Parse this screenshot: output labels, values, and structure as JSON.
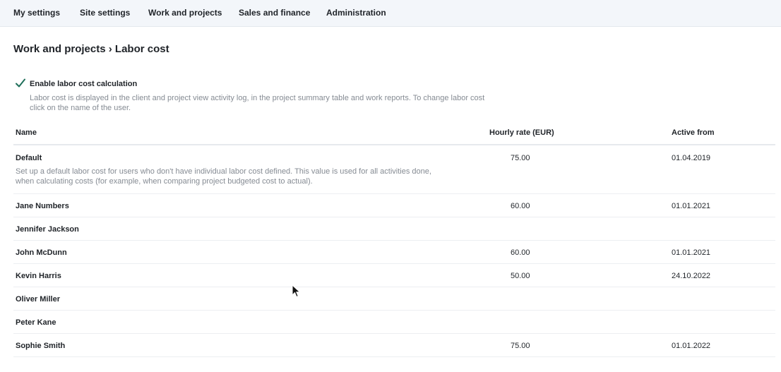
{
  "nav": {
    "items": [
      {
        "label": "My settings"
      },
      {
        "label": "Site settings"
      },
      {
        "label": "Work and projects"
      },
      {
        "label": "Sales and finance"
      },
      {
        "label": "Administration"
      }
    ]
  },
  "page": {
    "title": "Work and projects › Labor cost"
  },
  "setting": {
    "checkbox_checked": true,
    "label": "Enable labor cost calculation",
    "description": "Labor cost is displayed in the client and project view activity log, in the project summary table and work reports. To change labor cost click on the name of the user."
  },
  "table": {
    "columns": {
      "name": "Name",
      "rate": "Hourly rate (EUR)",
      "active": "Active from"
    },
    "rows": [
      {
        "name": "Default",
        "rate": "75.00",
        "active": "01.04.2019",
        "description": "Set up a default labor cost for users who don't have individual labor cost defined. This value is used for all activities done, when calculating costs (for example, when comparing project budgeted cost to actual)."
      },
      {
        "name": "Jane Numbers",
        "rate": "60.00",
        "active": "01.01.2021"
      },
      {
        "name": "Jennifer Jackson",
        "rate": "",
        "active": ""
      },
      {
        "name": "John McDunn",
        "rate": "60.00",
        "active": "01.01.2021"
      },
      {
        "name": "Kevin Harris",
        "rate": "50.00",
        "active": "24.10.2022"
      },
      {
        "name": "Oliver Miller",
        "rate": "",
        "active": ""
      },
      {
        "name": "Peter Kane",
        "rate": "",
        "active": ""
      },
      {
        "name": "Sophie Smith",
        "rate": "75.00",
        "active": "01.01.2022"
      }
    ]
  },
  "colors": {
    "nav_background": "#f3f6fa",
    "check_mark": "#1f6f5a",
    "muted_text": "#858b93"
  },
  "icons": {
    "checkbox": "check-mark-icon",
    "cursor": "mouse-pointer-icon"
  }
}
